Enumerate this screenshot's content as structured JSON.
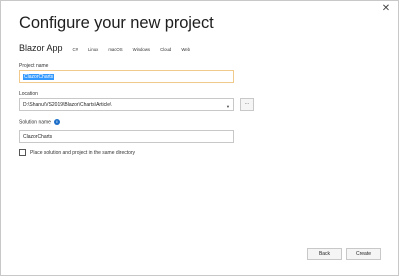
{
  "window": {
    "close_glyph": "✕"
  },
  "page": {
    "title": "Configure your new project"
  },
  "template": {
    "name": "Blazor App",
    "tags": [
      "C#",
      "Linux",
      "macOS",
      "Windows",
      "Cloud",
      "Web"
    ]
  },
  "project_name": {
    "label": "Project name",
    "value": "ClazorCharts"
  },
  "location": {
    "label": "Location",
    "value": "D:\\Shanu\\VS2019\\Blazor\\Charts\\Article\\",
    "browse_label": "..."
  },
  "solution_name": {
    "label": "Solution name",
    "value": "ClazorCharts",
    "info_icon": "i"
  },
  "checkbox": {
    "label": "Place solution and project in the same directory",
    "checked": false
  },
  "buttons": {
    "back": "Back",
    "create": "Create"
  },
  "colors": {
    "selection": "#3399ff",
    "focus_border": "#f0c98d",
    "info": "#1c6fc9"
  }
}
